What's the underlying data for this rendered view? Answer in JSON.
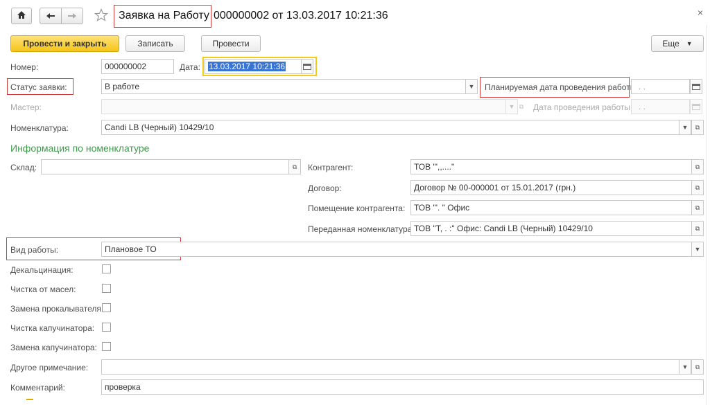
{
  "header": {
    "title_part1": "Заявка на Работу",
    "title_part2": "000000002 от 13.03.2017 10:21:36",
    "close": "×"
  },
  "toolbar": {
    "post_close": "Провести и закрыть",
    "write": "Записать",
    "post": "Провести",
    "more": "Еще"
  },
  "form": {
    "number_label": "Номер:",
    "number": "000000002",
    "date_label": "Дата:",
    "date": "13.03.2017 10:21:36",
    "status_label": "Статус заявки:",
    "status": "В работе",
    "planned_date_label": "Планируемая дата проведения работы:",
    "planned_date": ".  .",
    "master_label": "Мастер:",
    "master": "",
    "work_date_label": "Дата проведения работы:",
    "work_date": ".  .",
    "nomenclature_label": "Номенклатура:",
    "nomenclature": "Candi LB (Черный) 10429/10"
  },
  "info_section": {
    "title": "Информация по номенклатуре",
    "warehouse_label": "Склад:",
    "warehouse": "",
    "counterparty_label": "Контрагент:",
    "counterparty": "ТОВ \"',,....\"",
    "contract_label": "Договор:",
    "contract": "Договор № 00-000001 от 15.01.2017 (грн.)",
    "premises_label": "Помещение контрагента:",
    "premises": "ТОВ \"'.          \" Офис",
    "transferred_label": "Переданная номенклатура:",
    "transferred": "ТОВ \"Т,    .  :\" Офис: Candi LB (Черный) 10429/10"
  },
  "work": {
    "work_type_label": "Вид работы:",
    "work_type": "Плановое ТО",
    "checks": [
      {
        "label": "Декальцинация:"
      },
      {
        "label": "Чистка от масел:"
      },
      {
        "label": "Замена прокалывателя:"
      },
      {
        "label": "Чистка капучинатора:"
      },
      {
        "label": "Замена капучинатора:"
      }
    ],
    "other_note_label": "Другое примечание:",
    "other_note": "",
    "comment_label": "Комментарий:",
    "comment": "проверка"
  }
}
